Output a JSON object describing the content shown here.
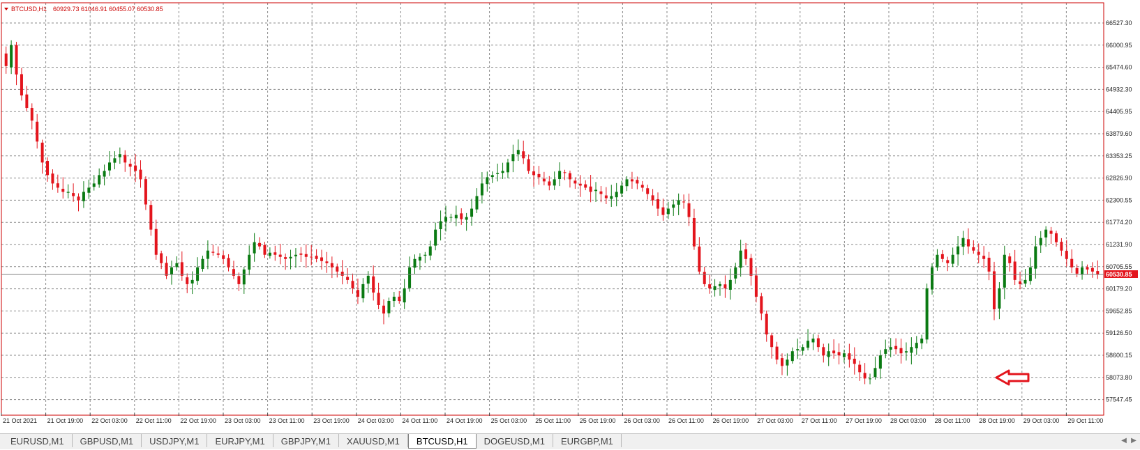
{
  "colors": {
    "bull": "#0a7a12",
    "bear": "#e3141c",
    "grid": "#8a8a8a",
    "frame": "#cc0000",
    "price_line": "#808080",
    "label_bg": "#e3141c",
    "arrow": "#e3141c"
  },
  "chart_header": {
    "symbol": "BTCUSD,H1",
    "ohlc": "60929.73 61046.91 60455.07 60530.85"
  },
  "current_price_label": "60530.85",
  "chart_data": {
    "type": "candlestick",
    "symbol": "BTCUSD",
    "timeframe": "H1",
    "price_ticks": [
      "66527.30",
      "66000.95",
      "65474.60",
      "64932.30",
      "64405.95",
      "63879.60",
      "63353.25",
      "62826.90",
      "62300.55",
      "61774.20",
      "61231.90",
      "60705.55",
      "60179.20",
      "59652.85",
      "59126.50",
      "58600.15",
      "58073.80",
      "57547.45"
    ],
    "time_ticks": [
      "21 Oct 2021",
      "21 Oct 19:00",
      "22 Oct 03:00",
      "22 Oct 11:00",
      "22 Oct 19:00",
      "23 Oct 03:00",
      "23 Oct 11:00",
      "23 Oct 19:00",
      "24 Oct 03:00",
      "24 Oct 11:00",
      "24 Oct 19:00",
      "25 Oct 03:00",
      "25 Oct 11:00",
      "25 Oct 19:00",
      "26 Oct 03:00",
      "26 Oct 11:00",
      "26 Oct 19:00",
      "27 Oct 03:00",
      "27 Oct 11:00",
      "27 Oct 19:00",
      "28 Oct 03:00",
      "28 Oct 11:00",
      "28 Oct 19:00",
      "29 Oct 03:00",
      "29 Oct 11:00"
    ],
    "price_range": [
      57547.45,
      66800
    ],
    "grid": true,
    "last_price": 60530.85,
    "close_path": [
      65500,
      66000,
      65300,
      64800,
      64500,
      64200,
      63700,
      63200,
      62900,
      62700,
      62600,
      62500,
      62500,
      62400,
      62300,
      62500,
      62600,
      62700,
      62900,
      63000,
      63200,
      63300,
      63400,
      63200,
      63100,
      63000,
      62800,
      62200,
      61600,
      61000,
      60800,
      60500,
      60700,
      60800,
      60500,
      60300,
      60400,
      60700,
      60900,
      61100,
      61050,
      61000,
      60900,
      60700,
      60500,
      60300,
      60650,
      61000,
      61300,
      61200,
      61000,
      61050,
      61000,
      60950,
      60900,
      60950,
      61000,
      61000,
      60950,
      60950,
      60900,
      60850,
      60800,
      60700,
      60600,
      60500,
      60400,
      60200,
      60000,
      60300,
      60500,
      60100,
      59800,
      59600,
      59900,
      60000,
      59900,
      60200,
      60700,
      60900,
      60950,
      61000,
      61200,
      61600,
      61800,
      61900,
      61900,
      61950,
      61850,
      61900,
      62100,
      62400,
      62700,
      62850,
      62900,
      62950,
      63000,
      63200,
      63400,
      63500,
      63300,
      63000,
      62900,
      62850,
      62750,
      62650,
      62800,
      63000,
      62950,
      62800,
      62700,
      62650,
      62600,
      62500,
      62550,
      62450,
      62350,
      62400,
      62500,
      62650,
      62800,
      62750,
      62700,
      62600,
      62450,
      62300,
      62100,
      61950,
      62100,
      62200,
      62300,
      62250,
      61900,
      61200,
      60600,
      60300,
      60200,
      60250,
      60300,
      60200,
      60400,
      60700,
      61100,
      60900,
      60500,
      60000,
      59600,
      59100,
      58800,
      58500,
      58350,
      58500,
      58700,
      58750,
      58800,
      58950,
      59000,
      58800,
      58600,
      58700,
      58650,
      58600,
      58650,
      58500,
      58400,
      58200,
      58050,
      58050,
      58300,
      58600,
      58750,
      58800,
      58750,
      58650,
      58700,
      58800,
      58900,
      59000,
      60200,
      60700,
      61000,
      60900,
      60800,
      61000,
      61200,
      61400,
      61200,
      61100,
      61000,
      60900,
      60600,
      59700,
      60200,
      61000,
      60800,
      60400,
      60300,
      60400,
      60700,
      61200,
      61400,
      61600,
      61500,
      61300,
      61100,
      60900,
      60700,
      60550,
      60700,
      60650,
      60600,
      60530.85
    ]
  },
  "annotation": {
    "type": "arrow",
    "direction": "left"
  },
  "tabs": [
    {
      "label": "EURUSD,M1",
      "active": false
    },
    {
      "label": "GBPUSD,M1",
      "active": false
    },
    {
      "label": "USDJPY,M1",
      "active": false
    },
    {
      "label": "EURJPY,M1",
      "active": false
    },
    {
      "label": "GBPJPY,M1",
      "active": false
    },
    {
      "label": "XAUUSD,M1",
      "active": false
    },
    {
      "label": "BTCUSD,H1",
      "active": true
    },
    {
      "label": "DOGEUSD,M1",
      "active": false
    },
    {
      "label": "EURGBP,M1",
      "active": false
    }
  ],
  "icons": {
    "scroll_left": "chevron-left-icon",
    "scroll_right": "chevron-right-icon",
    "header_marker": "triangle-down-icon"
  }
}
